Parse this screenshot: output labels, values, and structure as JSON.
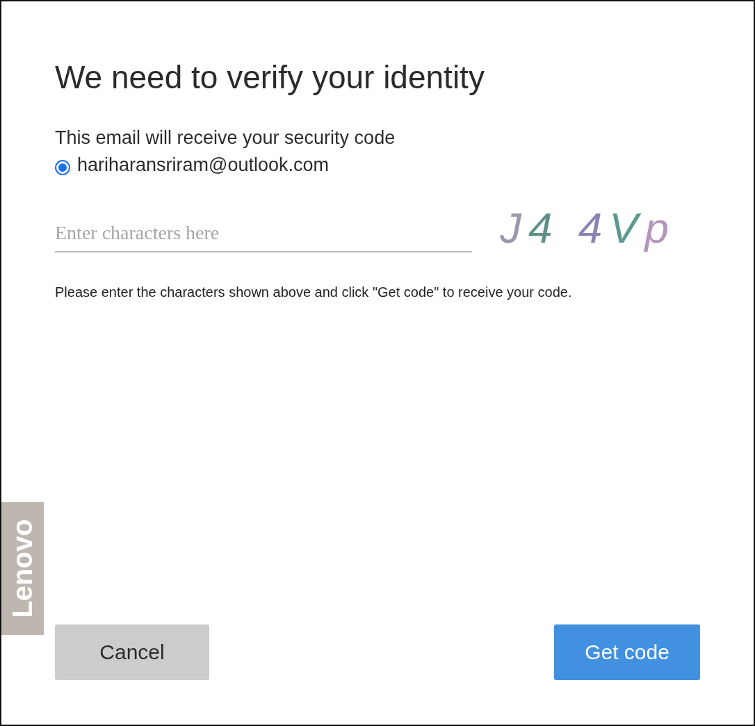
{
  "title": "We need to verify your identity",
  "email_section": {
    "label": "This email will receive your security code",
    "options": [
      {
        "label": "hariharansriram@outlook.com",
        "selected": true
      }
    ]
  },
  "captcha_input": {
    "placeholder": "Enter characters here"
  },
  "captcha": [
    {
      "text": "J",
      "color": "#9a98aa"
    },
    {
      "text": "4",
      "color": "#5f8f88"
    },
    {
      "text": " 4",
      "color": "#8a82b2"
    },
    {
      "text": "V",
      "color": "#5a9a8e"
    },
    {
      "text": "p",
      "color": "#b494bc"
    }
  ],
  "instructions": "Please enter the characters shown above and click \"Get code\" to receive your code.",
  "brand": "Lenovo",
  "buttons": [
    {
      "label": "Cancel",
      "kind": "secondary"
    },
    {
      "label": "Get code",
      "kind": "primary"
    }
  ]
}
